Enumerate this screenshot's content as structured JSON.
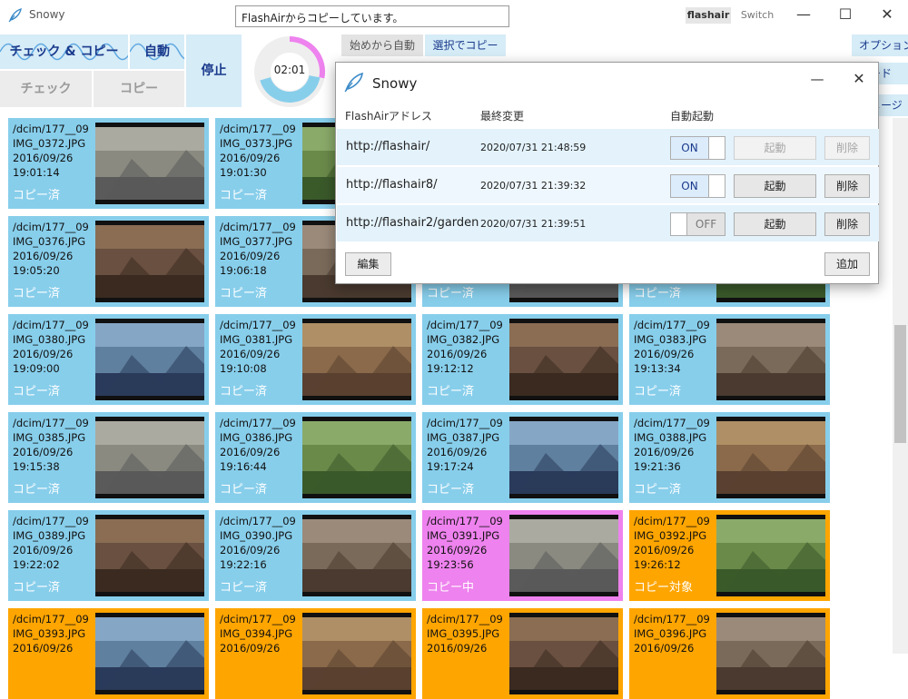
{
  "window": {
    "title": "Snowy",
    "status_message": "FlashAirからコピーしています。",
    "profile_active": "flashair",
    "profile_other": "Switch",
    "min_glyph": "—",
    "max_glyph": "☐",
    "close_glyph": "✕"
  },
  "toolbar": {
    "check_copy": "チェック & コピー",
    "auto": "自動",
    "check": "チェック",
    "copy": "コピー",
    "stop": "停止",
    "timer": "02:01",
    "timer_progress": 0.28,
    "from_start": "始めから自動",
    "select_copy": "選択でコピー"
  },
  "side_tabs": {
    "options": "オプション",
    "card": "カード",
    "image": "イメージ"
  },
  "colors": {
    "copied": "#87ceeb",
    "copying": "#ee82ee",
    "target": "#ffa500",
    "accent": "#1a3a8c"
  },
  "files": [
    {
      "folder": "/dcim/177__09",
      "name": "IMG_0372.JPG",
      "date": "2016/09/26",
      "time": "19:01:14",
      "status": "コピー済",
      "state": "copied"
    },
    {
      "folder": "/dcim/177__09",
      "name": "IMG_0373.JPG",
      "date": "2016/09/26",
      "time": "19:01:30",
      "status": "コピー済",
      "state": "copied"
    },
    {
      "folder": "",
      "name": "",
      "date": "",
      "time": "",
      "status": "",
      "state": "copied"
    },
    {
      "folder": "",
      "name": "",
      "date": "",
      "time": "",
      "status": "",
      "state": "copied"
    },
    {
      "folder": "/dcim/177__09",
      "name": "IMG_0376.JPG",
      "date": "2016/09/26",
      "time": "19:05:20",
      "status": "コピー済",
      "state": "copied"
    },
    {
      "folder": "/dcim/177__09",
      "name": "IMG_0377.JPG",
      "date": "2016/09/26",
      "time": "19:06:18",
      "status": "コピー済",
      "state": "copied"
    },
    {
      "folder": "",
      "name": "",
      "date": "",
      "time": "",
      "status": "コピー済",
      "state": "copied"
    },
    {
      "folder": "",
      "name": "",
      "date": "",
      "time": "",
      "status": "コピー済",
      "state": "copied"
    },
    {
      "folder": "/dcim/177__09",
      "name": "IMG_0380.JPG",
      "date": "2016/09/26",
      "time": "19:09:00",
      "status": "コピー済",
      "state": "copied"
    },
    {
      "folder": "/dcim/177__09",
      "name": "IMG_0381.JPG",
      "date": "2016/09/26",
      "time": "19:10:08",
      "status": "コピー済",
      "state": "copied"
    },
    {
      "folder": "/dcim/177__09",
      "name": "IMG_0382.JPG",
      "date": "2016/09/26",
      "time": "19:12:12",
      "status": "コピー済",
      "state": "copied"
    },
    {
      "folder": "/dcim/177__09",
      "name": "IMG_0383.JPG",
      "date": "2016/09/26",
      "time": "19:13:34",
      "status": "コピー済",
      "state": "copied"
    },
    {
      "folder": "/dcim/177__09",
      "name": "IMG_0385.JPG",
      "date": "2016/09/26",
      "time": "19:15:38",
      "status": "コピー済",
      "state": "copied"
    },
    {
      "folder": "/dcim/177__09",
      "name": "IMG_0386.JPG",
      "date": "2016/09/26",
      "time": "19:16:44",
      "status": "コピー済",
      "state": "copied"
    },
    {
      "folder": "/dcim/177__09",
      "name": "IMG_0387.JPG",
      "date": "2016/09/26",
      "time": "19:17:24",
      "status": "コピー済",
      "state": "copied"
    },
    {
      "folder": "/dcim/177__09",
      "name": "IMG_0388.JPG",
      "date": "2016/09/26",
      "time": "19:21:36",
      "status": "コピー済",
      "state": "copied"
    },
    {
      "folder": "/dcim/177__09",
      "name": "IMG_0389.JPG",
      "date": "2016/09/26",
      "time": "19:22:02",
      "status": "コピー済",
      "state": "copied"
    },
    {
      "folder": "/dcim/177__09",
      "name": "IMG_0390.JPG",
      "date": "2016/09/26",
      "time": "19:22:16",
      "status": "コピー済",
      "state": "copied"
    },
    {
      "folder": "/dcim/177__09",
      "name": "IMG_0391.JPG",
      "date": "2016/09/26",
      "time": "19:23:56",
      "status": "コピー中",
      "state": "copying"
    },
    {
      "folder": "/dcim/177__09",
      "name": "IMG_0392.JPG",
      "date": "2016/09/26",
      "time": "19:26:12",
      "status": "コピー対象",
      "state": "target"
    },
    {
      "folder": "/dcim/177__09",
      "name": "IMG_0393.JPG",
      "date": "2016/09/26",
      "time": "",
      "status": "",
      "state": "target"
    },
    {
      "folder": "/dcim/177__09",
      "name": "IMG_0394.JPG",
      "date": "2016/09/26",
      "time": "",
      "status": "",
      "state": "target"
    },
    {
      "folder": "/dcim/177__09",
      "name": "IMG_0395.JPG",
      "date": "2016/09/26",
      "time": "",
      "status": "",
      "state": "target"
    },
    {
      "folder": "/dcim/177__09",
      "name": "IMG_0396.JPG",
      "date": "2016/09/26",
      "time": "",
      "status": "",
      "state": "target"
    }
  ],
  "dialog": {
    "title": "Snowy",
    "minimize": "—",
    "close": "✕",
    "headers": {
      "address": "FlashAirアドレス",
      "modified": "最終変更",
      "auto_start": "自動起動"
    },
    "rows": [
      {
        "address": "http://flashair/",
        "modified": "2020/07/31 21:48:59",
        "auto": "ON",
        "auto_on": true,
        "start": "起動",
        "delete": "削除",
        "enabled": false
      },
      {
        "address": "http://flashair8/",
        "modified": "2020/07/31 21:39:32",
        "auto": "ON",
        "auto_on": true,
        "start": "起動",
        "delete": "削除",
        "enabled": true
      },
      {
        "address": "http://flashair2/garden",
        "modified": "2020/07/31 21:39:51",
        "auto": "OFF",
        "auto_on": false,
        "start": "起動",
        "delete": "削除",
        "enabled": true
      }
    ],
    "edit": "編集",
    "add": "追加"
  }
}
